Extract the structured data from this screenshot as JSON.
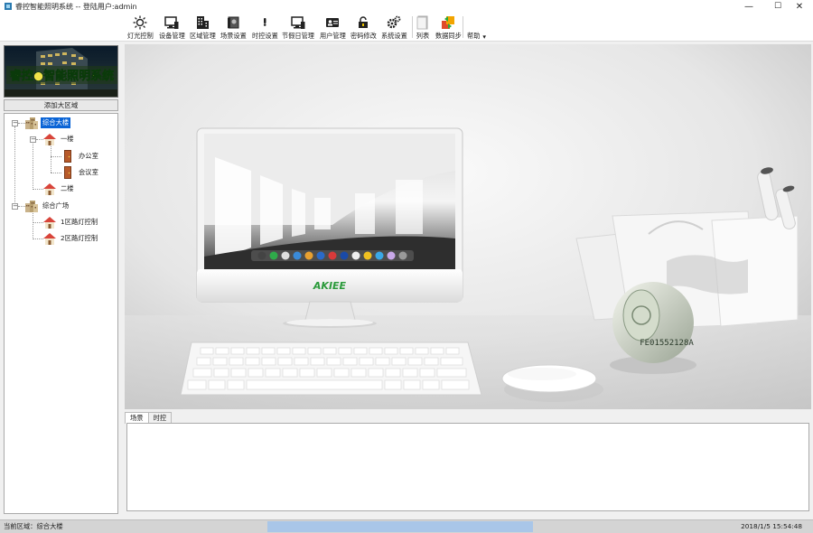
{
  "window": {
    "title": "睿控智能照明系统  --  登陆用户:admin",
    "minimize": "—",
    "maximize": "☐",
    "close": "✕"
  },
  "toolbar": {
    "items": [
      {
        "label": "灯光控制",
        "icon": "light-icon"
      },
      {
        "label": "设备管理",
        "icon": "device-icon"
      },
      {
        "label": "区域管理",
        "icon": "building-icon"
      },
      {
        "label": "场景设置",
        "icon": "scene-icon"
      },
      {
        "label": "时控设置",
        "icon": "timer-icon"
      },
      {
        "label": "节假日管理",
        "icon": "holiday-icon"
      },
      {
        "label": "用户管理",
        "icon": "user-icon"
      },
      {
        "label": "密码修改",
        "icon": "password-icon"
      },
      {
        "label": "系统设置",
        "icon": "gear-icon"
      },
      {
        "label": "列表",
        "icon": "list-icon"
      },
      {
        "label": "数据同步",
        "icon": "sync-icon"
      }
    ],
    "help_label": "帮助",
    "help_arrow": "▾"
  },
  "logo": {
    "text": "睿控●智能照明系统"
  },
  "left_panel": {
    "add_region_label": "添加大区域"
  },
  "tree": {
    "nodes": [
      {
        "label": "综合大楼"
      },
      {
        "label": "一楼"
      },
      {
        "label": "办公室"
      },
      {
        "label": "会议室"
      },
      {
        "label": "二楼"
      },
      {
        "label": "综合广场"
      },
      {
        "label": "1区路灯控制"
      },
      {
        "label": "2区路灯控制"
      }
    ],
    "collapse_sign": "−"
  },
  "main_image": {
    "brand": "AKIEE",
    "banknote_text": "FE01552128A"
  },
  "tabs": [
    {
      "label": "场景"
    },
    {
      "label": "时控"
    }
  ],
  "status": {
    "current_area": "当前区域：综合大楼",
    "datetime": "2018/1/5 15:54:48"
  },
  "colors": {
    "selection": "#0a64d6",
    "progress": "#a9c6e8"
  }
}
